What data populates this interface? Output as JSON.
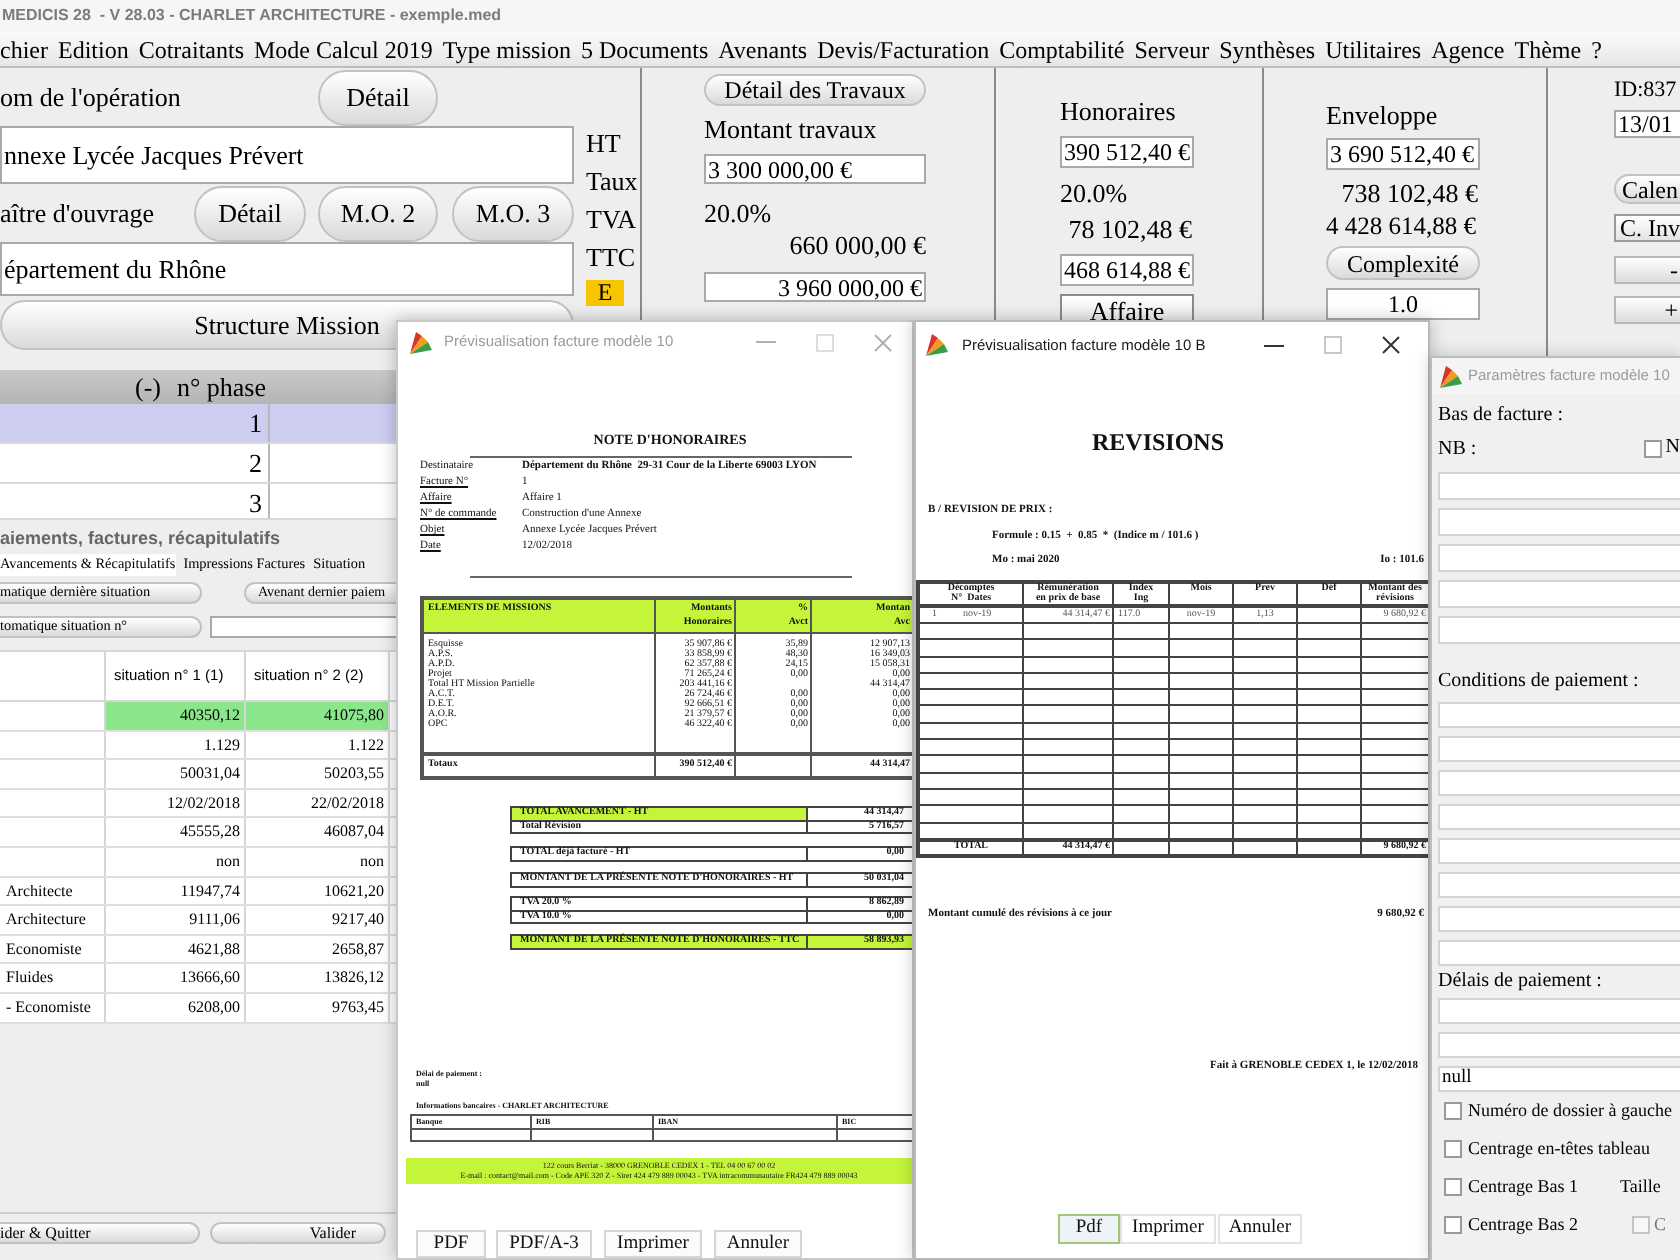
{
  "app": {
    "title": "MEDICIS 28  - V 28.03 - CHARLET ARCHITECTURE - exemple.med"
  },
  "menu": [
    "chier",
    "Edition",
    "Cotraitants",
    "Mode Calcul 2019",
    "Type mission",
    "5 Documents",
    "Avenants",
    "Devis/Facturation",
    "Comptabilité",
    "Serveur",
    "Synthèses",
    "Utilitaires",
    "Agence",
    "Thème",
    "?"
  ],
  "operation": {
    "label": "om de l'opération",
    "button": "Détail",
    "value": "nnexe Lycée Jacques Prévert"
  },
  "owner": {
    "label": "aître d'ouvrage",
    "buttons": [
      "Détail",
      "M.O. 2",
      "M.O. 3"
    ],
    "value": "épartement du Rhône"
  },
  "structure_button": "Structure Mission",
  "amount_labels": [
    "HT",
    "Taux",
    "TVA",
    "TTC"
  ],
  "flag": "E",
  "travaux": {
    "button": "Détail des Travaux",
    "label": "Montant travaux",
    "ht": "3 300 000,00 €",
    "rate": "20.0%",
    "tva": "660 000,00 €",
    "ttc": "3 960 000,00 €"
  },
  "honoraires": {
    "label": "Honoraires",
    "ht": "390 512,40 €",
    "rate": "20.0%",
    "tva": "78 102,48 €",
    "ttc": "468 614,88 €",
    "button": "Affaire"
  },
  "enveloppe": {
    "label": "Enveloppe",
    "ht": "3 690 512,40 €",
    "tva": "738 102,48 €",
    "ttc": "4 428 614,88 €",
    "button": "Complexité",
    "complexity": "1.0"
  },
  "id_panel": {
    "id": "ID:837",
    "date": "13/01",
    "buttons": [
      "Calen",
      "C. Inv",
      "-",
      "+"
    ]
  },
  "phase_table": {
    "columns": [
      "(-)",
      "n° phase"
    ],
    "rows": [
      {
        "phase": "1",
        "selected": true
      },
      {
        "phase": "2",
        "selected": false
      },
      {
        "phase": "3",
        "selected": false
      }
    ]
  },
  "payments": {
    "title": "aiements, factures, récapitulatifs",
    "tabs": [
      {
        "label": "Avancements & Récapitulatifs",
        "selected": true
      },
      {
        "label": "Impressions Factures",
        "selected": false
      },
      {
        "label": "Situation",
        "selected": false
      }
    ],
    "buttons": [
      "matique dernière situation",
      "Avenant dernier paiem"
    ],
    "situation_button": "tomatique situation n°",
    "columns": [
      "situation n° 1 (1)",
      "situation n° 2 (2)"
    ],
    "rows": [
      {
        "values": [
          "40350,12",
          "41075,80"
        ],
        "highlight": true
      },
      {
        "values": [
          "1.129",
          "1.122"
        ],
        "highlight": false
      },
      {
        "values": [
          "50031,04",
          "50203,55"
        ],
        "highlight": false
      },
      {
        "values": [
          "12/02/2018",
          "22/02/2018"
        ],
        "highlight": false
      },
      {
        "values": [
          "45555,28",
          "46087,04"
        ],
        "highlight": false
      },
      {
        "values": [
          "non",
          "non"
        ],
        "highlight": false
      },
      {
        "label": "Architecte",
        "values": [
          "11947,74",
          "10621,20"
        ],
        "highlight": false
      },
      {
        "label": "Architecture",
        "values": [
          "9111,06",
          "9217,40"
        ],
        "highlight": false
      },
      {
        "label": "Economiste",
        "values": [
          "4621,88",
          "2658,87"
        ],
        "highlight": false
      },
      {
        "label": "Fluides",
        "values": [
          "13666,60",
          "13826,12"
        ],
        "highlight": false
      },
      {
        "label": "- Economiste",
        "values": [
          "6208,00",
          "9763,45"
        ],
        "highlight": false
      }
    ],
    "footer_buttons": [
      "ider & Quitter",
      "Valider"
    ]
  },
  "invoice_window": {
    "title": "Prévisualisation facture modèle 10",
    "active": false,
    "heading": "NOTE D'HONORAIRES",
    "info": [
      {
        "label": "Destinataire",
        "value": "Département du Rhône  29-31 Cour de la Liberte 69003 LYON",
        "underline": false,
        "bold": true
      },
      {
        "label": "Facture N°",
        "value": "1",
        "underline": true,
        "bold": false
      },
      {
        "label": "Affaire",
        "value": "Affaire 1",
        "underline": true,
        "bold": false
      },
      {
        "label": "N° de commande",
        "value": "Construction d'une Annexe",
        "underline": true,
        "bold": false
      },
      {
        "label": "Objet",
        "value": "Annexe Lycée Jacques Prévert",
        "underline": true,
        "bold": false
      },
      {
        "label": "Date",
        "value": "12/02/2018",
        "underline": true,
        "bold": false
      }
    ],
    "missions": {
      "columns": [
        [
          "ELEMENTS DE MISSIONS"
        ],
        [
          "Montants",
          "Honoraires"
        ],
        [
          "%",
          "Avct"
        ],
        [
          "Montan",
          "Avc"
        ]
      ],
      "rows": [
        {
          "name": "Esquisse",
          "amount": "35 907,86 €",
          "percent": "35,89",
          "progress": "12 907,13"
        },
        {
          "name": "A.P.S.",
          "amount": "33 858,99 €",
          "percent": "48,30",
          "progress": "16 349,03"
        },
        {
          "name": "A.P.D.",
          "amount": "62 357,88 €",
          "percent": "24,15",
          "progress": "15 058,31"
        },
        {
          "name": "Projet",
          "amount": "71 265,24 €",
          "percent": "0,00",
          "progress": "0,00"
        },
        {
          "name": "Total HT Mission Partielle",
          "amount": "203 441,16 €",
          "progress": "44 314,47"
        },
        {
          "name": "A.C.T.",
          "amount": "26 724,46 €",
          "percent": "0,00",
          "progress": "0,00"
        },
        {
          "name": "D.E.T.",
          "amount": "92 666,51 €",
          "percent": "0,00",
          "progress": "0,00"
        },
        {
          "name": "A.O.R.",
          "amount": "21 379,57 €",
          "percent": "0,00",
          "progress": "0,00"
        },
        {
          "name": "OPC",
          "amount": "46 322,40 €",
          "percent": "0,00",
          "progress": "0,00"
        }
      ],
      "total": {
        "name": "Totaux",
        "amount": "390 512,40 €",
        "progress": "44 314,47"
      }
    },
    "summary": [
      {
        "rows": [
          {
            "label": "TOTAL AVANCEMENT - HT",
            "value": "44 314,47",
            "label_filled": true,
            "value_filled": false
          },
          {
            "label": "Total Révision",
            "value": "5 716,57",
            "label_filled": false,
            "value_filled": false
          }
        ]
      },
      {
        "rows": [
          {
            "label": "TOTAL déjà facturé - HT",
            "value": "0,00",
            "label_filled": false,
            "value_filled": false
          }
        ]
      },
      {
        "rows": [
          {
            "label": "MONTANT DE LA PRÉSENTE NOTE D'HONORAIRES - HT",
            "value": "50 031,04",
            "label_filled": false,
            "value_filled": false
          }
        ]
      },
      {
        "rows": [
          {
            "label": "TVA 20.0 %",
            "value": "8 862,89",
            "label_filled": false,
            "value_filled": false
          },
          {
            "label": "TVA 10.0 %",
            "value": "0,00",
            "label_filled": false,
            "value_filled": false
          }
        ]
      },
      {
        "rows": [
          {
            "label": "MONTANT DE LA PRÉSENTE NOTE D'HONORAIRES - TTC",
            "value": "58 893,93",
            "label_filled": true,
            "value_filled": true
          }
        ]
      }
    ],
    "payment_delay": {
      "label": "Délai de paiement :",
      "value": "null"
    },
    "bank": {
      "title": "Informations bancaires - CHARLET ARCHITECTURE",
      "columns": [
        "Banque",
        "RIB",
        "IBAN",
        "BIC"
      ]
    },
    "footer": [
      "122 cours Berriat - 38000 GRENOBLE CEDEX 1 - TEL 04 00 67 00 02",
      "E-mail : contact@mail.com - Code APE 320 Z - Siret 424 479 889 00043 - TVA intracommunautaire FR424 479 889 00043"
    ],
    "buttons": [
      "PDF",
      "PDF/A-3",
      "Imprimer",
      "Annuler"
    ]
  },
  "revision_window": {
    "title": "Prévisualisation facture modèle 10 B",
    "active": true,
    "heading": "REVISIONS",
    "section": "B / REVISION DE PRIX :",
    "formula": "Formule : 0.15  +  0.85  *  (Indice m / 101.6 )",
    "mo": "Mo : mai 2020",
    "io": "Io : 101.6",
    "columns": [
      [
        "Décomptes",
        "N°  Dates"
      ],
      [
        "Rémunération",
        "en prix de base"
      ],
      [
        "Index",
        "Ing"
      ],
      [
        "Mois"
      ],
      [
        "Prev"
      ],
      [
        "Déf"
      ],
      [
        "Montant des",
        "révisions"
      ]
    ],
    "rows": [
      {
        "number": "1",
        "date": "nov-19",
        "base": "44 314,47 €",
        "index": "117.0",
        "month": "nov-19",
        "prev": "1,13",
        "amount": "9 680,92 €"
      }
    ],
    "total": {
      "label": "TOTAL",
      "base": "44 314,47 €",
      "amount": "9 680,92 €"
    },
    "cumulative": {
      "label": "Montant cumulé des révisions à ce jour",
      "value": "9 680,92 €"
    },
    "signature": "Fait à GRENOBLE CEDEX 1, le 12/02/2018",
    "buttons": [
      {
        "label": "Pdf",
        "focused": true
      },
      {
        "label": "Imprimer",
        "focused": false
      },
      {
        "label": "Annuler",
        "focused": false
      }
    ]
  },
  "settings_window": {
    "title": "Paramètres facture modèle 10",
    "active": false,
    "footer_label": "Bas de facture :",
    "nb": {
      "label": "NB :",
      "option": {
        "label": "N",
        "checked": false
      }
    },
    "conditions_label": "Conditions de paiement :",
    "delays_label": "Délais de paiement :",
    "delay_value": "null",
    "options": [
      {
        "label": "Numéro de dossier à gauche",
        "checked": false
      },
      {
        "label": "Centrage en-têtes tableau",
        "checked": false
      },
      {
        "label": "Centrage Bas 1",
        "checked": false,
        "note": "Taille"
      },
      {
        "label": "Centrage Bas 2",
        "checked": false,
        "extra": {
          "label": "C",
          "checked": false,
          "disabled": true
        }
      }
    ]
  }
}
